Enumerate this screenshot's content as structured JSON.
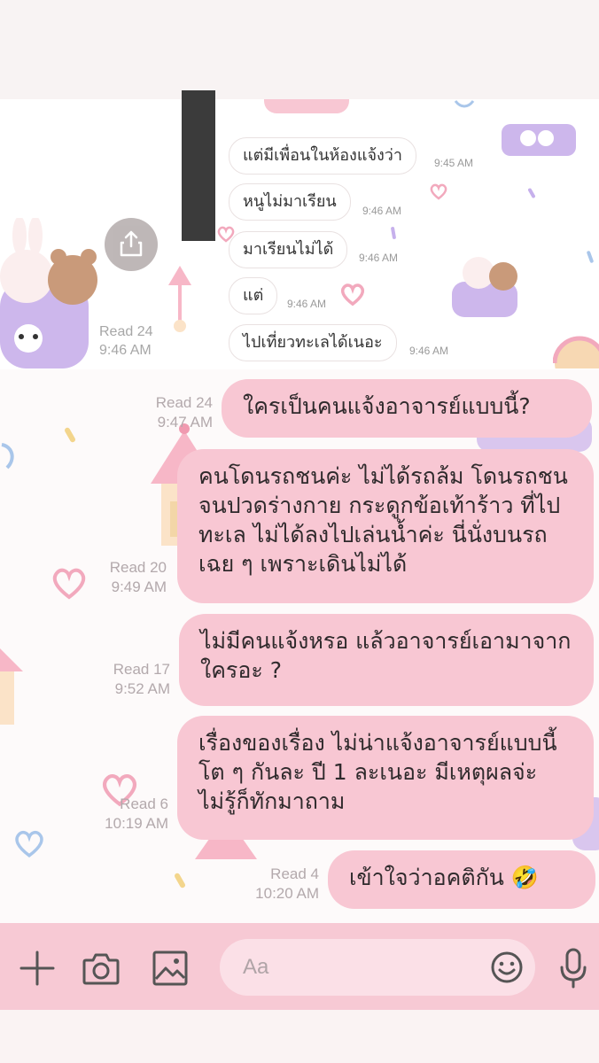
{
  "inner_messages": [
    {
      "text": "แต่มีเพื่อนในห้องแจ้งว่า",
      "time": "9:45 AM"
    },
    {
      "text": "หนูไม่มาเรียน",
      "time": "9:46 AM"
    },
    {
      "text": "มาเรียนไม่ได้",
      "time": "9:46 AM"
    },
    {
      "text": "แต่",
      "time": "9:46 AM"
    },
    {
      "text": "ไปเที่ยวทะเลได้เนอะ",
      "time": "9:46 AM"
    }
  ],
  "inner_read": {
    "read": "Read 24",
    "time": "9:46 AM"
  },
  "messages": [
    {
      "text": "ใครเป็นคนแจ้งอาจารย์แบบนี้?",
      "read": "Read 24",
      "time": "9:47 AM"
    },
    {
      "text": "คนโดนรถชนค่ะ ไม่ได้รถล้ม โดนรถชนจนปวดร่างกาย กระดูกข้อเท้าร้าว ที่ไปทะเล ไม่ได้ลงไปเล่นน้ำค่ะ นี่นั่งบนรถเฉย ๆ เพราะเดินไม่ได้",
      "read": "Read 20",
      "time": "9:49 AM"
    },
    {
      "text": "ไม่มีคนแจ้งหรอ แล้วอาจารย์เอามาจากใครอะ ?",
      "read": "Read 17",
      "time": "9:52 AM"
    },
    {
      "text": "เรื่องของเรื่อง ไม่น่าแจ้งอาจารย์แบบนี้ โต ๆ กันละ ปี 1 ละเนอะ มีเหตุผลจ่ะ ไม่รู้ก็ทักมาถาม",
      "read": "Read 6",
      "time": "10:19 AM"
    },
    {
      "text": "เข้าใจว่าอคติกัน 🤣",
      "read": "Read 4",
      "time": "10:20 AM"
    }
  ],
  "input": {
    "placeholder": "Aa"
  },
  "icons": {
    "add": "plus-icon",
    "camera": "camera-icon",
    "gallery": "image-icon",
    "emoji": "smiley-icon",
    "mic": "microphone-icon",
    "share": "share-icon"
  },
  "colors": {
    "bubble": "#f8c7d3",
    "input_bar": "#f7c9d4",
    "read_text": "#b3a9ac"
  }
}
